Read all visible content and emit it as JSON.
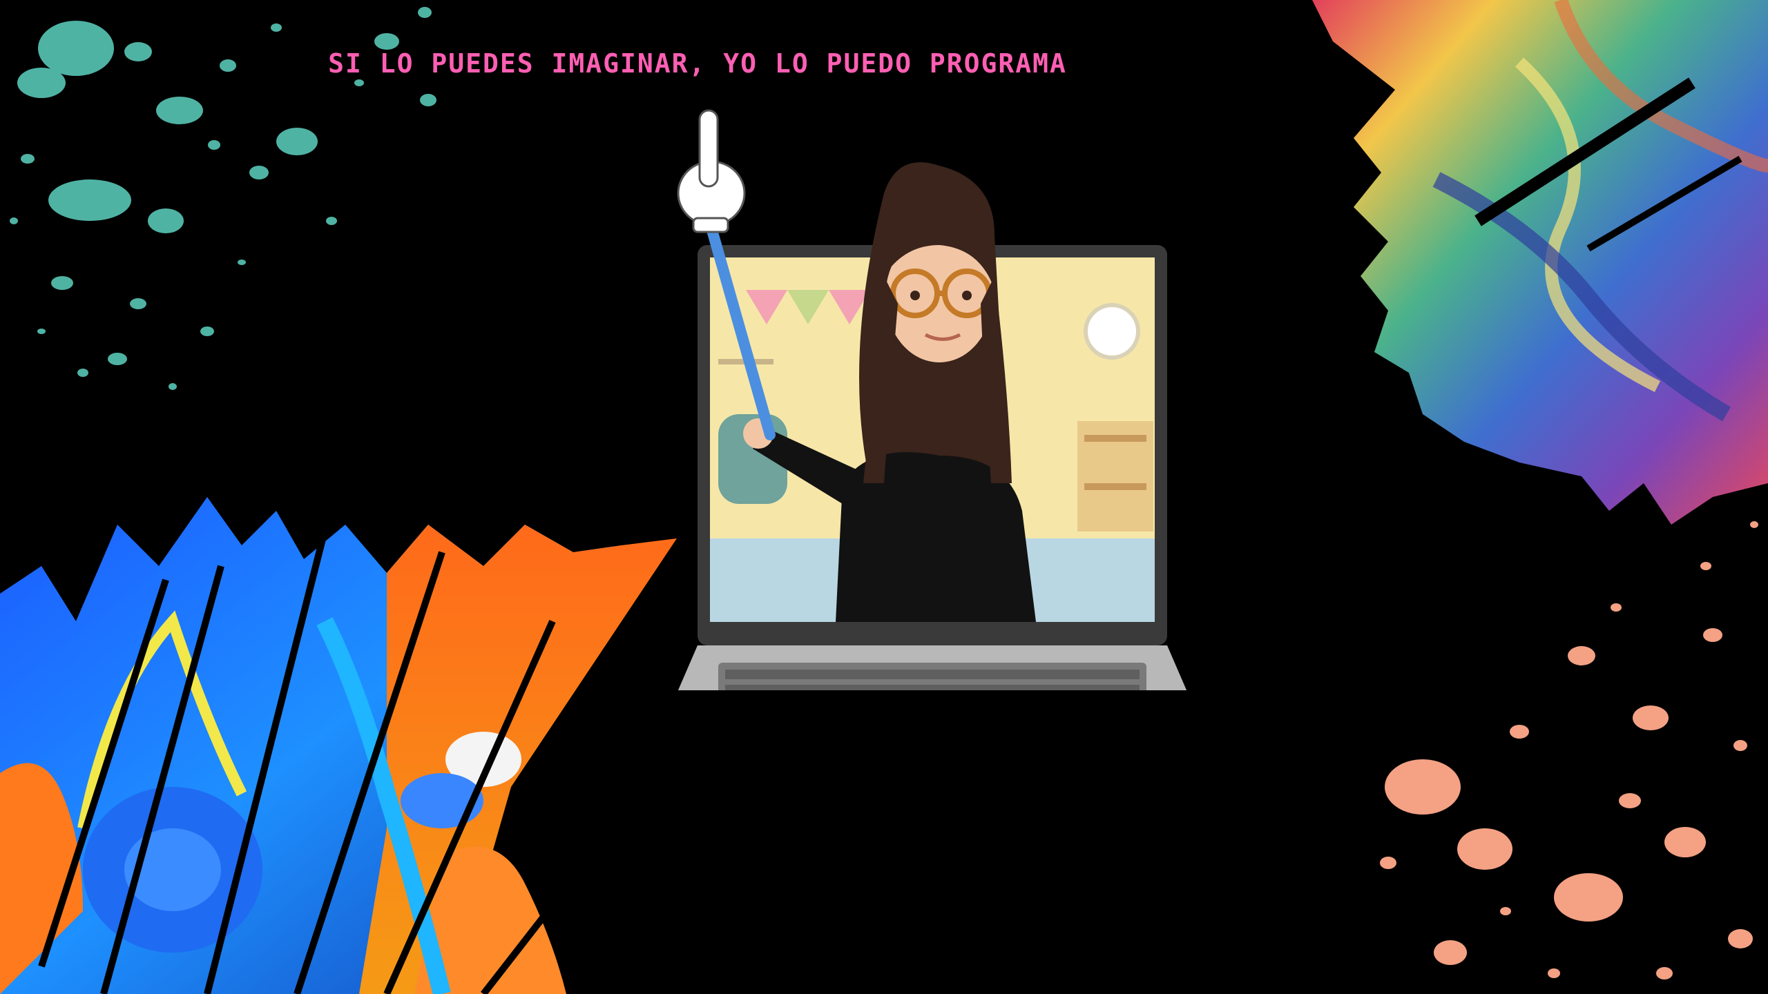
{
  "page": {
    "headline": "SI LO PUEDES IMAGINAR, YO LO PUEDO PROGRAMA"
  },
  "colors": {
    "background": "#000000",
    "headline": "#ff5fb3",
    "teal_splatter": "#4fb3a4",
    "peach_splatter": "#f4a184"
  },
  "illustration": {
    "subject": "avatar-in-laptop-pointing"
  }
}
